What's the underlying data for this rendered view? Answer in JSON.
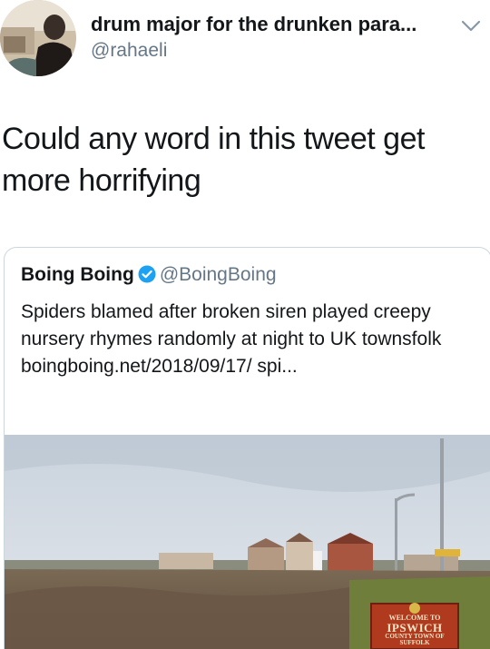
{
  "tweet": {
    "display_name": "drum major for the drunken para...",
    "handle": "@rahaeli",
    "text": "Could any word in this tweet get more horrifying"
  },
  "quoted_tweet": {
    "display_name": "Boing Boing",
    "handle": "@BoingBoing",
    "text": "Spiders blamed after broken siren played creepy nursery rhymes randomly at night to UK townsfolk boingboing.net/2018/09/17/ spi...",
    "photo": {
      "sign_lines": [
        "WELCOME TO",
        "IPSWICH",
        "COUNTY TOWN OF",
        "SUFFOLK"
      ]
    }
  },
  "icons": {
    "verified": "verified-badge-icon",
    "menu": "chevron-down-icon"
  },
  "colors": {
    "verified_blue": "#1da1f2",
    "handle_gray": "#657786",
    "sign_red": "#b03a1e"
  }
}
